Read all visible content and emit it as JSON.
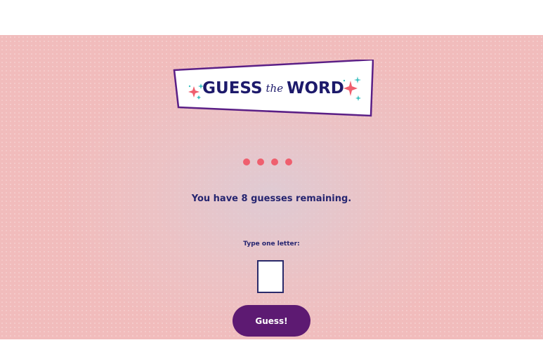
{
  "logo": {
    "word1": "GUESS",
    "word2": "the",
    "word3": "WORD"
  },
  "word": {
    "letters_hidden": 4,
    "blank_color": "#ef5f6e"
  },
  "status": {
    "remaining_text": "You have 8 guesses remaining."
  },
  "form": {
    "label": "Type one letter:",
    "input_value": "",
    "button_label": "Guess!"
  },
  "colors": {
    "panel_background": "#f1bcbc",
    "text_navy": "#262570",
    "button_purple": "#5d1a72",
    "logo_border": "#5b1f86",
    "sparkle_pink": "#ef5f6e",
    "sparkle_teal": "#3fc1c0"
  }
}
